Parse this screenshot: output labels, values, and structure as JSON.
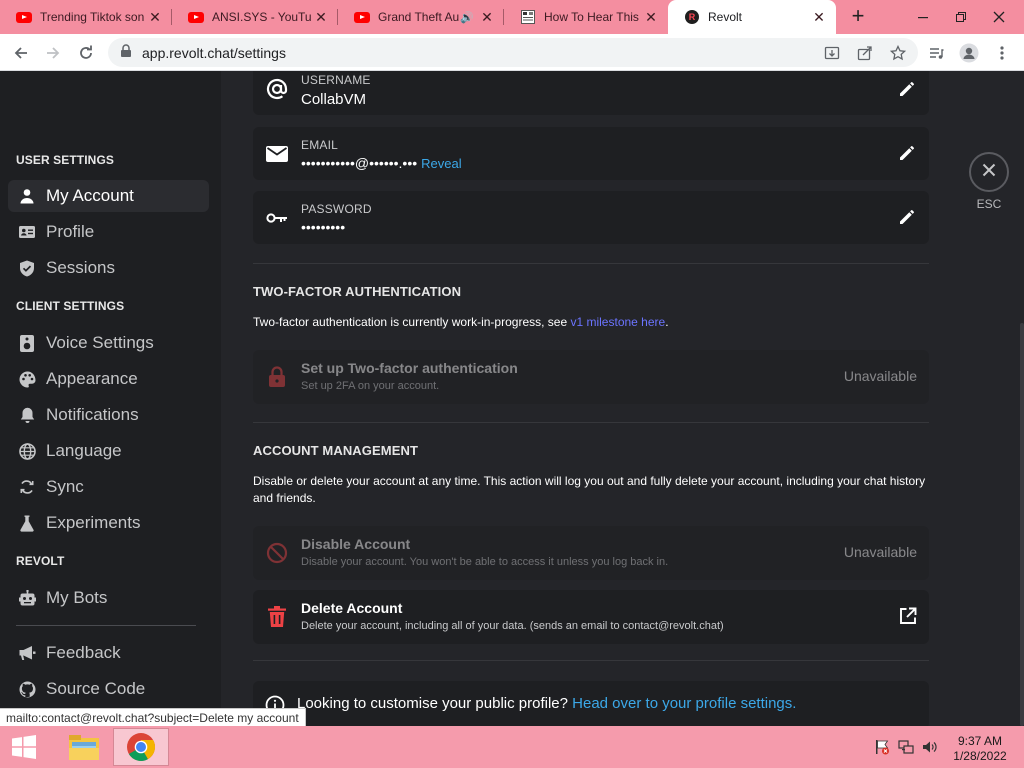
{
  "browser": {
    "tabs": [
      {
        "title": "Trending Tiktok son",
        "icon": "youtube-icon"
      },
      {
        "title": "ANSI.SYS - YouTub",
        "icon": "youtube-icon"
      },
      {
        "title": "Grand Theft Au",
        "icon": "youtube-icon"
      },
      {
        "title": "How To Hear This",
        "icon": "page-icon"
      },
      {
        "title": "Revolt",
        "icon": "revolt-icon"
      }
    ],
    "revolt_favicon_letter": "R",
    "url": "app.revolt.chat/settings"
  },
  "sidebar": {
    "categories": [
      "USER SETTINGS",
      "CLIENT SETTINGS",
      "REVOLT"
    ],
    "items": [
      {
        "label": "My Account",
        "icon": "user-icon"
      },
      {
        "label": "Profile",
        "icon": "profile-card-icon"
      },
      {
        "label": "Sessions",
        "icon": "shield-icon"
      },
      {
        "label": "Voice Settings",
        "icon": "speaker-icon"
      },
      {
        "label": "Appearance",
        "icon": "palette-icon"
      },
      {
        "label": "Notifications",
        "icon": "bell-icon"
      },
      {
        "label": "Language",
        "icon": "globe-icon"
      },
      {
        "label": "Sync",
        "icon": "sync-icon"
      },
      {
        "label": "Experiments",
        "icon": "flask-icon"
      },
      {
        "label": "My Bots",
        "icon": "robot-icon"
      },
      {
        "label": "Feedback",
        "icon": "megaphone-icon"
      },
      {
        "label": "Source Code",
        "icon": "github-icon"
      }
    ]
  },
  "account": {
    "username": {
      "label": "USERNAME",
      "value": "CollabVM"
    },
    "email": {
      "label": "EMAIL",
      "value": "•••••••••••@••••••.•••",
      "reveal": "Reveal"
    },
    "password": {
      "label": "PASSWORD",
      "value": "•••••••••"
    }
  },
  "two_factor": {
    "title": "TWO-FACTOR AUTHENTICATION",
    "desc_prefix": "Two-factor authentication is currently work-in-progress, see ",
    "desc_link": "v1 milestone here",
    "desc_suffix": ".",
    "card_title": "Set up Two-factor authentication",
    "card_desc": "Set up 2FA on your account.",
    "card_status": "Unavailable"
  },
  "account_management": {
    "title": "ACCOUNT MANAGEMENT",
    "desc": "Disable or delete your account at any time. This action will log you out and fully delete your account, including your chat history and friends.",
    "disable": {
      "title": "Disable Account",
      "desc": "Disable your account. You won't be able to access it unless you log back in.",
      "status": "Unavailable"
    },
    "delete": {
      "title": "Delete Account",
      "desc": "Delete your account, including all of your data. (sends an email to contact@revolt.chat)"
    }
  },
  "profile_tip": {
    "text": "Looking to customise your public profile? ",
    "link": "Head over to your profile settings."
  },
  "close": {
    "label": "ESC"
  },
  "status_url": "mailto:contact@revolt.chat?subject=Delete my account",
  "taskbar": {
    "time": "9:37 AM",
    "date": "1/28/2022"
  },
  "colors": {
    "accent_link": "#3ca8e8",
    "danger": "#ed4245",
    "milestone_link": "#6b74ff",
    "tabbar": "#f48ea0"
  }
}
